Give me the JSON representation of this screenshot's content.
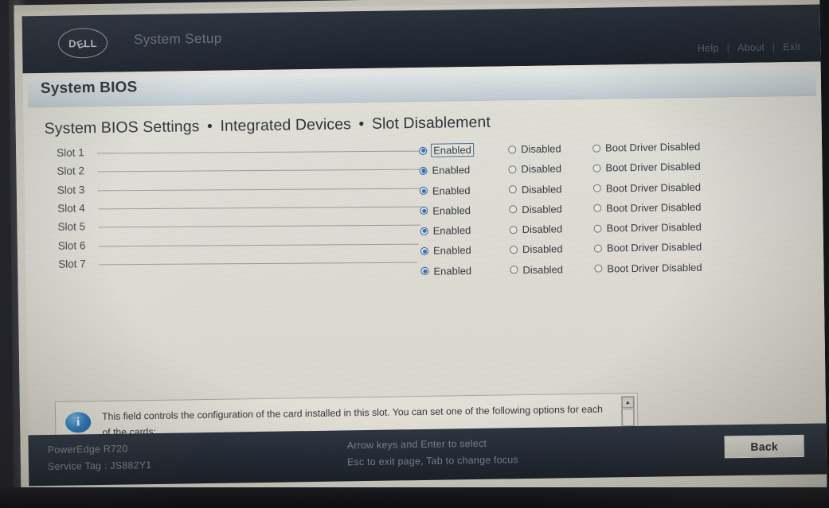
{
  "header": {
    "brand": "DELL",
    "app_title": "System Setup",
    "menu": [
      "Help",
      "About",
      "Exit"
    ],
    "separator": "|"
  },
  "section": {
    "band_title": "System BIOS",
    "breadcrumb": [
      "System BIOS Settings",
      "Integrated Devices",
      "Slot Disablement"
    ],
    "breadcrumb_separator": "•"
  },
  "options": {
    "enabled": "Enabled",
    "disabled": "Disabled",
    "boot_driver_disabled": "Boot Driver Disabled"
  },
  "slots": [
    {
      "label": "Slot 1",
      "selected": "enabled",
      "focused": true
    },
    {
      "label": "Slot 2",
      "selected": "enabled",
      "focused": false
    },
    {
      "label": "Slot 3",
      "selected": "enabled",
      "focused": false
    },
    {
      "label": "Slot 4",
      "selected": "enabled",
      "focused": false
    },
    {
      "label": "Slot 5",
      "selected": "enabled",
      "focused": false
    },
    {
      "label": "Slot 6",
      "selected": "enabled",
      "focused": false
    },
    {
      "label": "Slot 7",
      "selected": "enabled",
      "focused": false
    }
  ],
  "help": {
    "icon": "info-icon",
    "text": "This field controls the configuration of the card installed in this slot. You can set one of the following options for each of the cards:",
    "scroll_up": "▲",
    "scroll_down": "▼"
  },
  "footer": {
    "model": "PowerEdge R720",
    "service_tag": "Service Tag : JS882Y1",
    "hint_1": "Arrow keys and Enter to select",
    "hint_2": "Esc to exit page, Tab to change focus",
    "back_label": "Back"
  },
  "colors": {
    "accent_blue": "#2f6fc0",
    "titlebar": "#222a36",
    "panel": "#e3e3dc",
    "band": "#d3dde2",
    "info_blue": "#2f7fc4"
  }
}
